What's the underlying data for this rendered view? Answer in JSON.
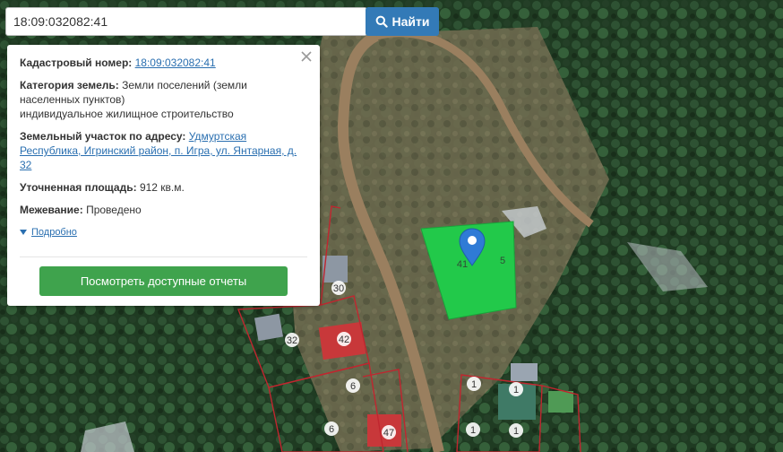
{
  "search": {
    "value": "18:09:032082:41",
    "button_label": "Найти"
  },
  "popup": {
    "cadastral": {
      "label": "Кадастровый номер:",
      "value": "18:09:032082:41"
    },
    "category": {
      "label": "Категория земель:",
      "value": "Земли поселений (земли населенных пунктов)",
      "value2": "индивидуальное жилищное строительство"
    },
    "address": {
      "label": "Земельный участок по адресу:",
      "value": "Удмуртская Республика, Игринский район, п. Игра, ул. Янтарная, д. 32"
    },
    "area": {
      "label": "Уточненная площадь:",
      "value": "912 кв.м."
    },
    "survey": {
      "label": "Межевание:",
      "value": "Проведено"
    },
    "more_label": "Подробно",
    "reports_button": "Посмотреть доступные отчеты"
  },
  "map": {
    "parcel_labels": [
      "30",
      "32",
      "42",
      "6",
      "6",
      "47",
      "1",
      "1",
      "1",
      "1",
      "41",
      "5"
    ],
    "colors": {
      "selected_parcel": "#22c94a",
      "parcel_border": "#c0262f",
      "marker": "#2f7bd6",
      "search_button": "#337ab7",
      "reports_button": "#3fa34d"
    }
  }
}
